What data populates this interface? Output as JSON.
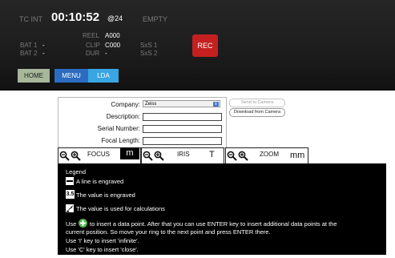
{
  "header": {
    "tc_label": "TC INT",
    "tc_value": "00:10:52",
    "tc_fps": "@24",
    "status": "EMPTY",
    "reel_label": "REEL",
    "reel_value": "A000",
    "clip_label": "CLIP",
    "clip_value": "C000",
    "dur_label": "DUR",
    "dur_value": "-",
    "bat1_label": "BAT 1",
    "bat1_value": "-",
    "bat2_label": "BAT 2",
    "bat2_value": "-",
    "sxs1": "SxS 1",
    "sxs2": "SxS 2",
    "rec_label": "REC"
  },
  "tabs": {
    "home": "HOME",
    "menu": "MENU",
    "lda": "LDA"
  },
  "form": {
    "company_label": "Company:",
    "company_value": "Zeiss",
    "description_label": "Description:",
    "serial_label": "Serial Number:",
    "focal_label": "Focal Length:",
    "send_button": "Send to Camera",
    "download_button": "Download from Camera"
  },
  "scales": {
    "focus_label": "FOCUS",
    "focus_unit": "m",
    "iris_label": "IRIS",
    "iris_unit": "T",
    "zoom_label": "ZOOM",
    "zoom_unit": "mm"
  },
  "legend": {
    "title": "Legend",
    "line_engraved": "A line is engraved",
    "value_engraved": "The value is engraved",
    "value_engraved_icon_text": "3.5",
    "value_used": "The value is used for calculations",
    "instruction_use": "Use",
    "instruction_after": "to insert a data point. After that you can use ENTER key to insert additional data points at the",
    "instruction_line2": "current position. So move your ring to the next point and press ENTER there.",
    "instruction_infinite": "Use 'I' key to insert 'infinite'.",
    "instruction_close": "Use 'C' key to insert 'close'."
  },
  "colors": {
    "rec": "#c42020",
    "home_tab": "#a7b79a",
    "menu_tab": "#2c6cc0",
    "lda_tab": "#39a5e3",
    "add_icon": "#4db34d"
  }
}
